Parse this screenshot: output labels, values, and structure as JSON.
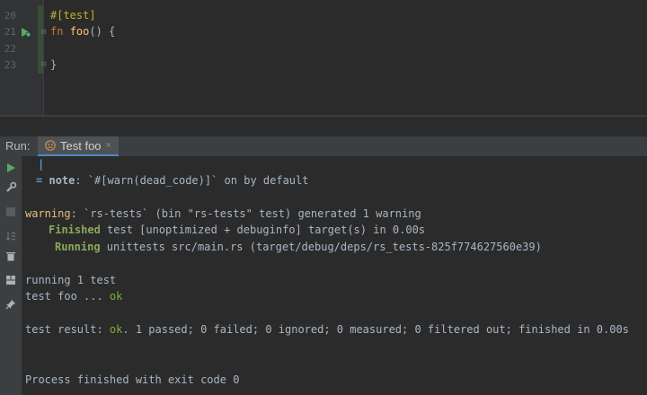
{
  "editor": {
    "line_numbers": [
      "20",
      "21",
      "22",
      "23"
    ],
    "line_attr": "#[test]",
    "line_fn_kw": "fn",
    "line_fn_name": "foo",
    "line_fn_rest": "() {",
    "line_close": "}"
  },
  "run_panel": {
    "label": "Run:",
    "tab_label": "Test foo",
    "tab_close": "×"
  },
  "console": {
    "pipe": "|",
    "note_eq": "=",
    "note_label": "note",
    "note_text": ": `#[warn(dead_code)]` on by default",
    "warning_label": "warning",
    "warning_text": ": `rs-tests` (bin \"rs-tests\" test) generated 1 warning",
    "finished_label": "Finished",
    "finished_text": " test [unoptimized + debuginfo] target(s) in 0.00s",
    "running_label": "Running",
    "running_text": " unittests src/main.rs (target/debug/deps/rs_tests-825f774627560e39)",
    "running_count": "running 1 test",
    "test_foo_prefix": "test foo ... ",
    "test_foo_ok": "ok",
    "result_prefix": "test result: ",
    "result_ok": "ok",
    "result_rest": ". 1 passed; 0 failed; 0 ignored; 0 measured; 0 filtered out; finished in 0.00s",
    "exit_text": "Process finished with exit code 0"
  },
  "colors": {
    "warning": "#e5c07b",
    "success": "#8ba957",
    "note": "#4a9bd8",
    "run_green": "#59a869"
  },
  "icons": [
    "run-test-gutter-icon",
    "fold-icon",
    "test-tab-icon",
    "rerun-icon",
    "wrench-icon",
    "stop-icon",
    "sort-icon",
    "trash-icon",
    "layout-icon",
    "pin-icon"
  ]
}
